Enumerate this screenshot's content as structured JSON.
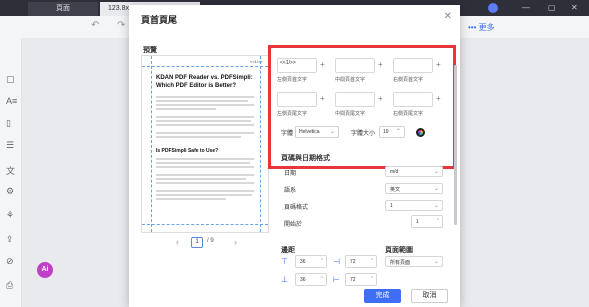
{
  "app": {
    "tab1": "頁面",
    "tab2": "123.8x...",
    "more_label": "••• 更多",
    "ai_badge": "Ai"
  },
  "dialog": {
    "title": "頁首頁尾",
    "preview_label": "預覽",
    "doc_title_line1": "KDAN PDF Reader vs. PDFSimpli:",
    "doc_title_line2": "Which PDF Editor is Better?",
    "doc_subheading": "Is PDFSimpli Safe to Use?",
    "header_sample_text": "<<1/>>",
    "page_current": "1",
    "page_total": "/ 9",
    "captions": {
      "header_left": "左側頁首文字",
      "header_center": "中間頁首文字",
      "header_right": "右側頁首文字",
      "footer_left": "左側頁尾文字",
      "footer_center": "中間頁尾文字",
      "footer_right": "右側頁尾文字"
    },
    "font": {
      "label": "字體",
      "value": "Helvetica",
      "size_label": "字體大小",
      "size_value": "19"
    },
    "page_format_section": "頁碼與日期格式",
    "date_label": "日期",
    "date_value": "m/d",
    "lang_label": "語系",
    "lang_value": "英文",
    "page_num_format_label": "頁碼格式",
    "page_num_format_value": "1",
    "start_page_label": "開始於",
    "start_page_value": "1",
    "margins_section": "邊距",
    "margin_top": "36",
    "margin_right": "72",
    "margin_bottom": "36",
    "margin_left": "72",
    "page_range_section": "頁面範圍",
    "page_range_value": "所有頁面",
    "ok_label": "完成",
    "cancel_label": "取消"
  }
}
